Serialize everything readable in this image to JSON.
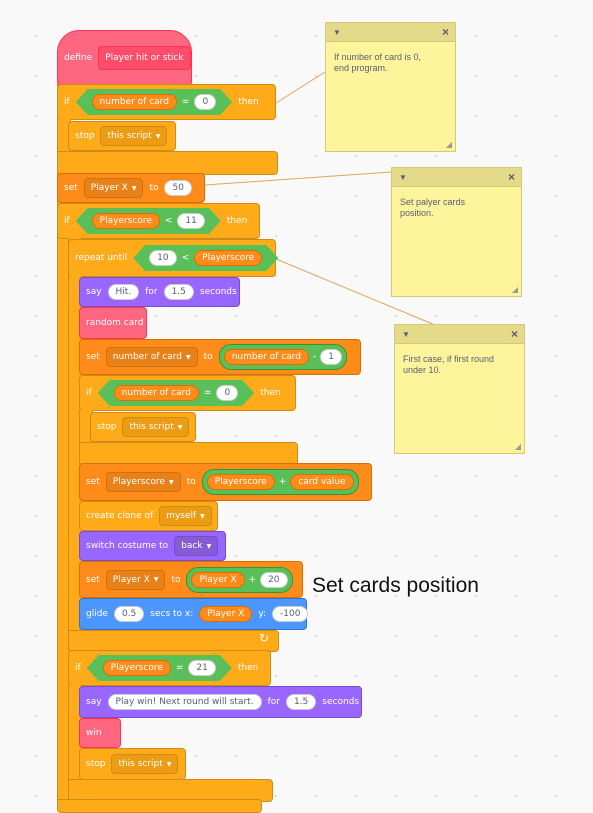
{
  "define": {
    "keyword": "define",
    "name": "Player hit or stick"
  },
  "if1": {
    "kw_if": "if",
    "var": "number of card",
    "op": "=",
    "value": "0",
    "kw_then": "then"
  },
  "stop1": {
    "kw": "stop",
    "option": "this script"
  },
  "set1": {
    "kw_set": "set",
    "var": "Player X",
    "kw_to": "to",
    "value": "50"
  },
  "if2": {
    "kw_if": "if",
    "var": "Playerscore",
    "op": "<",
    "value": "11",
    "kw_then": "then"
  },
  "repeat": {
    "kw": "repeat until",
    "value": "10",
    "op": "<",
    "var": "Playerscore"
  },
  "say1": {
    "kw": "say",
    "text": "Hit.",
    "kw_for": "for",
    "secs": "1.5",
    "kw_seconds": "seconds"
  },
  "random_card": "random card",
  "set2": {
    "kw_set": "set",
    "var": "number of card",
    "kw_to": "to",
    "var2": "number of card",
    "op": "-",
    "value": "1"
  },
  "if3": {
    "kw_if": "if",
    "var": "number of card",
    "op": "=",
    "value": "0",
    "kw_then": "then"
  },
  "stop2": {
    "kw": "stop",
    "option": "this script"
  },
  "set3": {
    "kw_set": "set",
    "var": "Playerscore",
    "kw_to": "to",
    "var2": "Playerscore",
    "op": "+",
    "var3": "card value"
  },
  "clone": {
    "kw": "create clone of",
    "option": "myself"
  },
  "costume": {
    "kw": "switch costume to",
    "option": "back"
  },
  "set4": {
    "kw_set": "set",
    "var": "Player X",
    "kw_to": "to",
    "var2": "Player X",
    "op": "+",
    "value": "20"
  },
  "glide": {
    "kw": "glide",
    "secs": "0.5",
    "kw_secs": "secs to x:",
    "x_var": "Player X",
    "kw_y": "y:",
    "y": "-100"
  },
  "if4": {
    "kw_if": "if",
    "var": "Playerscore",
    "op": "=",
    "value": "21",
    "kw_then": "then"
  },
  "say2": {
    "kw": "say",
    "text": "Play win! Next round will start.",
    "kw_for": "for",
    "secs": "1.5",
    "kw_seconds": "seconds"
  },
  "win": "win",
  "stop3": {
    "kw": "stop",
    "option": "this script"
  },
  "notes": [
    {
      "text": "If number of card is 0,\nend program."
    },
    {
      "text": "Set palyer cards\nposition."
    },
    {
      "text": "First case, if first round\nunder 10."
    }
  ],
  "annotation": "Set cards position",
  "icons": {
    "dropdown": "dropdown-arrow-icon",
    "loop": "loop-arrow-icon",
    "collapse": "collapse-icon",
    "close": "close-icon",
    "resize": "resize-grip-icon"
  },
  "colors": {
    "control": "#ffab19",
    "variables": "#ff8c1a",
    "operators": "#59c059",
    "looks": "#9966ff",
    "motion": "#4c97ff",
    "my_blocks": "#ff6680",
    "note": "#fef49c"
  }
}
